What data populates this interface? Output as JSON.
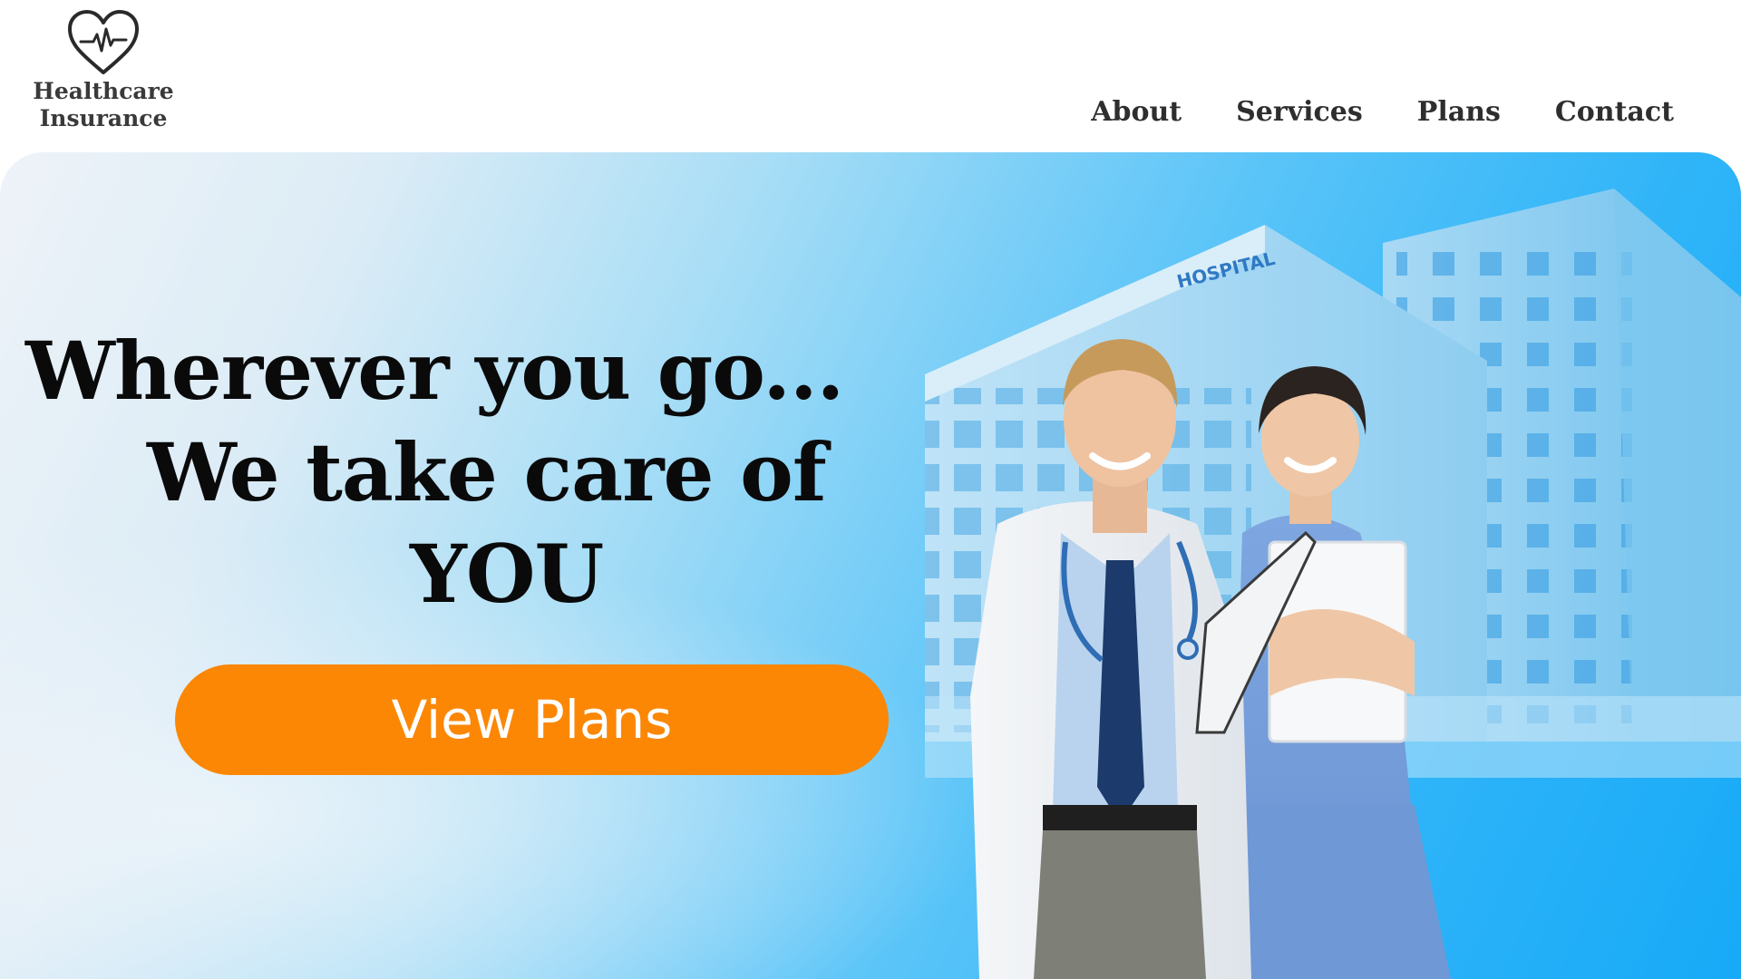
{
  "brand": {
    "line1": "Healthcare",
    "line2": "Insurance",
    "icon": "heart-pulse-icon"
  },
  "nav": {
    "items": [
      {
        "label": "About"
      },
      {
        "label": "Services"
      },
      {
        "label": "Plans"
      },
      {
        "label": "Contact"
      }
    ]
  },
  "hero": {
    "headline": [
      "Wherever you go...",
      "We take care of",
      "YOU"
    ],
    "cta_label": "View Plans",
    "building_sign": "HOSPITAL",
    "image": "doctor-and-nurse-in-front-of-hospital"
  },
  "colors": {
    "cta": "#fb8705",
    "hero_light": "#eef3f8",
    "hero_blue": "#17aaf7",
    "text_dark": "#0a0a0a"
  }
}
